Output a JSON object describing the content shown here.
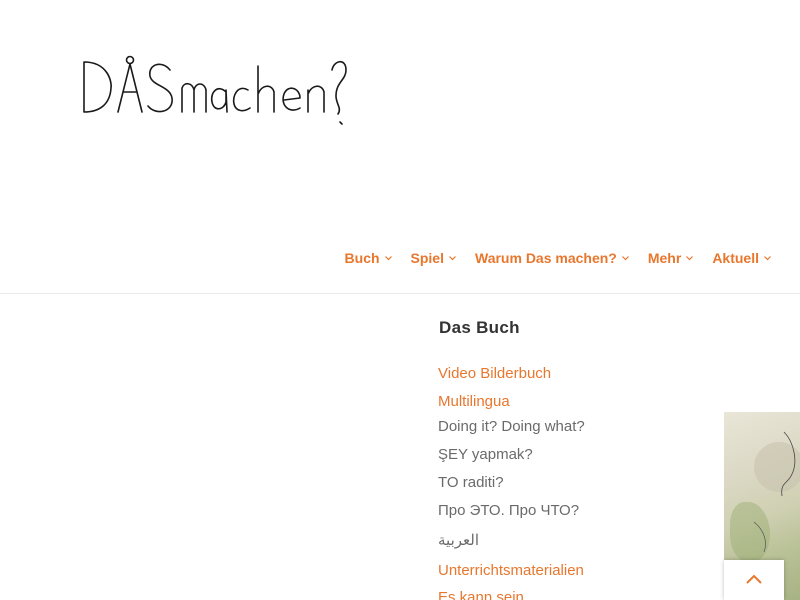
{
  "site": {
    "logo_text": "DAS machen?"
  },
  "nav": {
    "items": [
      {
        "label": "Buch"
      },
      {
        "label": "Spiel"
      },
      {
        "label": "Warum Das machen?"
      },
      {
        "label": "Mehr"
      },
      {
        "label": "Aktuell"
      }
    ]
  },
  "colors": {
    "accent": "#e8772e",
    "link_gray": "#6a6a6a",
    "heading": "#333333"
  },
  "sidebar": {
    "widget_title": "Das Buch",
    "links": [
      {
        "label": "Video Bilderbuch",
        "style": "orange"
      },
      {
        "label": "Multilingua",
        "style": "orange"
      },
      {
        "label": "Doing it? Doing what?",
        "style": "gray"
      },
      {
        "label": "ŞEY yapmak?",
        "style": "gray"
      },
      {
        "label": "TO raditi?",
        "style": "gray"
      },
      {
        "label": "Про ЭТО. Про ЧТО?",
        "style": "gray"
      },
      {
        "label": "العربية",
        "style": "gray"
      },
      {
        "label": "Unterrichtsmaterialien",
        "style": "orange"
      },
      {
        "label": "Es kann sein",
        "style": "orange"
      }
    ]
  },
  "icons": {
    "nav_chevron": "chevron-down-icon",
    "scroll_top": "chevron-up-icon"
  }
}
